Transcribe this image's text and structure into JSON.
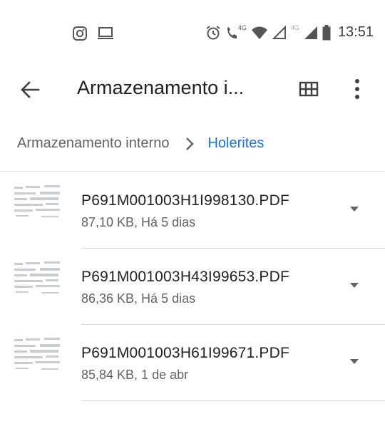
{
  "status_bar": {
    "time": "13:51",
    "network_labels": [
      "4G",
      "4G"
    ],
    "icons": [
      "instagram-icon",
      "monitor-icon",
      "alarm-icon",
      "wifi-call-icon",
      "wifi-icon",
      "signal-icon",
      "signal-icon",
      "battery-icon"
    ]
  },
  "app_bar": {
    "title": "Armazenamento i...",
    "icons": [
      "back-arrow-icon",
      "grid-view-icon",
      "more-vert-icon"
    ]
  },
  "breadcrumb": {
    "root": "Armazenamento interno",
    "current": "Holerites"
  },
  "files": [
    {
      "name": "P691M001003H1I998130.PDF",
      "meta": "87,10 KB, Há 5 dias"
    },
    {
      "name": "P691M001003H43I99653.PDF",
      "meta": "86,36 KB, Há 5 dias"
    },
    {
      "name": "P691M001003H61I99671.PDF",
      "meta": "85,84 KB, 1 de abr"
    }
  ],
  "colors": {
    "accent": "#1a73e8",
    "text_primary": "#202124",
    "text_secondary": "#5f6368",
    "divider": "#dadce0"
  }
}
